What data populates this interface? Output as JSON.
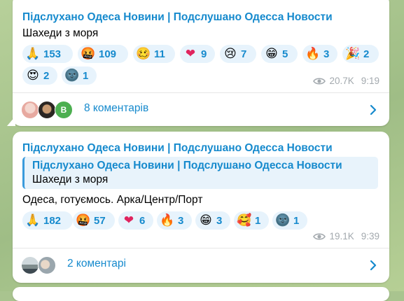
{
  "posts": [
    {
      "channel": "Підслухано Одеса Новини | Подслушано Одесса Новости",
      "text": "Шахеди з моря",
      "reactions": [
        {
          "emoji": "🙏",
          "icon": "folded-hands-icon",
          "count": "153"
        },
        {
          "emoji": "🤬",
          "icon": "cursing-face-icon",
          "count": "109"
        },
        {
          "emoji": "🥴",
          "icon": "woozy-face-icon",
          "count": "11"
        },
        {
          "emoji": "❤",
          "icon": "red-heart-icon",
          "count": "9"
        },
        {
          "emoji": "😢",
          "icon": "crying-face-icon",
          "count": "7"
        },
        {
          "emoji": "😁",
          "icon": "grinning-face-icon",
          "count": "5"
        },
        {
          "emoji": "🔥",
          "icon": "fire-icon",
          "count": "3"
        },
        {
          "emoji": "🎉",
          "icon": "party-popper-icon",
          "count": "2"
        },
        {
          "emoji": "😍",
          "icon": "heart-eyes-icon",
          "count": "2"
        },
        {
          "emoji": "🌚",
          "icon": "new-moon-face-icon",
          "count": "1"
        }
      ],
      "views": "20.7K",
      "time": "9:19",
      "avatar_letter": "В",
      "comments": "8 коментарів"
    },
    {
      "channel": "Підслухано Одеса Новини | Подслушано Одесса Новости",
      "quote": {
        "title": "Підслухано Одеса Новини | Подслушано Одесса Новости",
        "text": "Шахеди з моря"
      },
      "text": "Одеса, готуємось. Арка/Центр/Порт",
      "reactions": [
        {
          "emoji": "🙏",
          "icon": "folded-hands-icon",
          "count": "182"
        },
        {
          "emoji": "🤬",
          "icon": "cursing-face-icon",
          "count": "57"
        },
        {
          "emoji": "❤",
          "icon": "red-heart-icon",
          "count": "6"
        },
        {
          "emoji": "🔥",
          "icon": "fire-icon",
          "count": "3"
        },
        {
          "emoji": "😁",
          "icon": "grinning-face-icon",
          "count": "3"
        },
        {
          "emoji": "🥰",
          "icon": "smiling-hearts-icon",
          "count": "1"
        },
        {
          "emoji": "🌚",
          "icon": "new-moon-face-icon",
          "count": "1"
        }
      ],
      "views": "19.1K",
      "time": "9:39",
      "comments": "2 коментарі"
    }
  ],
  "colors": {
    "accent": "#168acd",
    "reaction_bg": "#e7f3fc",
    "meta_gray": "#a3a9ae",
    "background": "#a9c48f",
    "quote_bg": "#e8f3fb",
    "avatar_green": "#4caf50"
  }
}
